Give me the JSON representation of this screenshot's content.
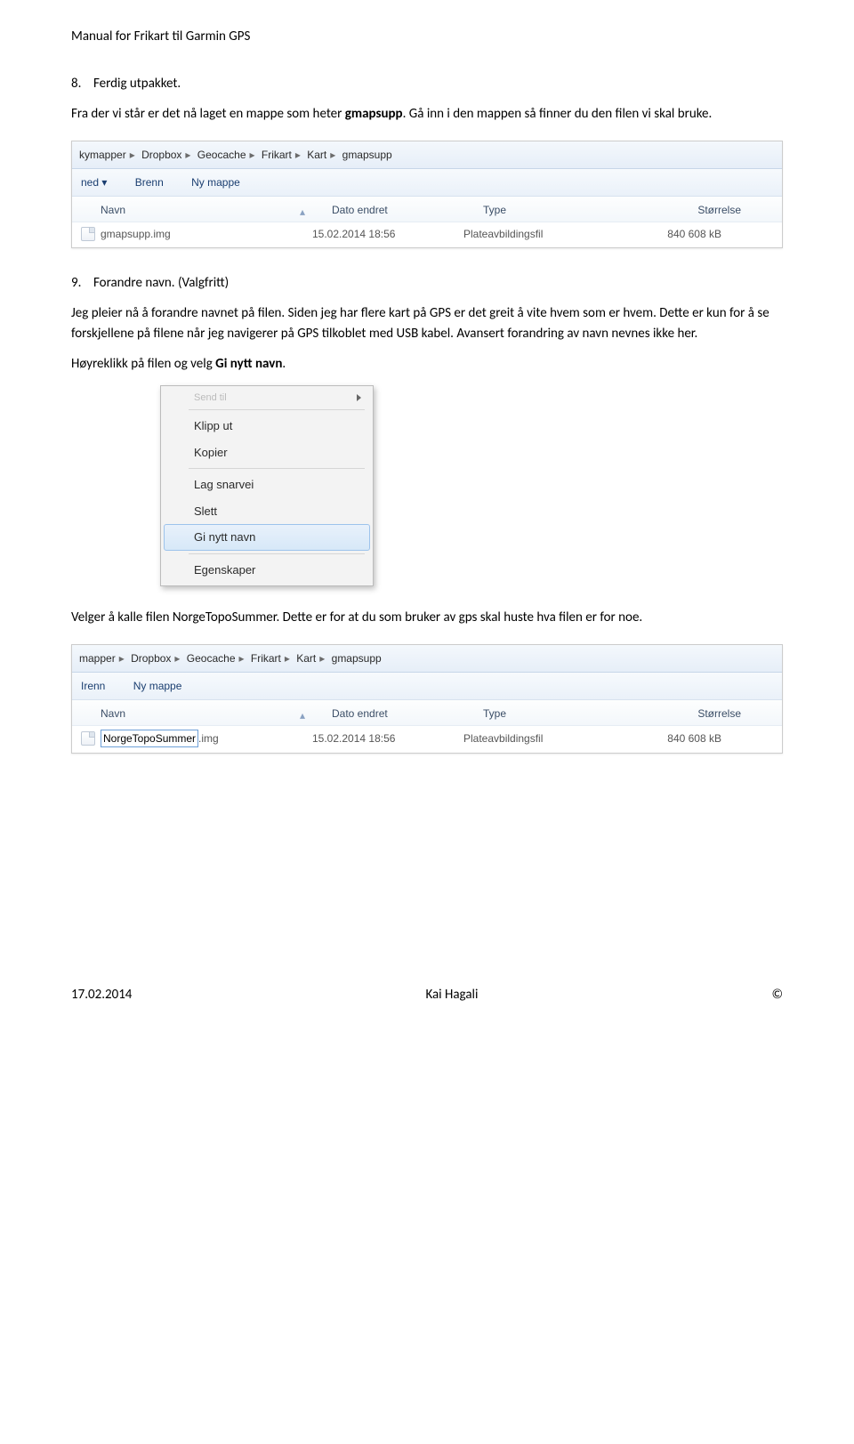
{
  "header": {
    "manual_title": "Manual for Frikart til Garmin GPS"
  },
  "section8": {
    "num": "8.",
    "heading": "Ferdig utpakket.",
    "p1_a": "Fra der vi står er det nå laget en mappe som heter ",
    "p1_bold": "gmapsupp",
    "p1_b": ". Gå inn i den mappen så finner du den filen vi skal bruke."
  },
  "explorer1": {
    "breadcrumb": [
      "kymapper",
      "Dropbox",
      "Geocache",
      "Frikart",
      "Kart",
      "gmapsupp"
    ],
    "toolbar": {
      "left": "ned ▾",
      "mid": "Brenn",
      "right": "Ny mappe"
    },
    "columns": {
      "name": "Navn",
      "date": "Dato endret",
      "type": "Type",
      "size": "Størrelse"
    },
    "row": {
      "name": "gmapsupp.img",
      "date": "15.02.2014 18:56",
      "type": "Plateavbildingsfil",
      "size": "840 608 kB"
    }
  },
  "section9": {
    "num": "9.",
    "heading": "Forandre navn. (Valgfritt)",
    "p1": "Jeg pleier nå å forandre navnet på filen. Siden jeg har flere kart på GPS er det greit å vite hvem som er hvem. Dette er kun for å se forskjellene på filene når jeg navigerer på GPS tilkoblet med USB kabel. Avansert forandring av navn nevnes ikke her.",
    "p2_a": "Høyreklikk på filen og velg ",
    "p2_bold": "Gi nytt navn",
    "p2_b": "."
  },
  "context_menu": {
    "ghost": "Send til",
    "items_top": [
      "Klipp ut",
      "Kopier"
    ],
    "items_mid": [
      "Lag snarvei",
      "Slett"
    ],
    "selected": "Gi nytt navn",
    "items_bottom": [
      "Egenskaper"
    ]
  },
  "section9b": {
    "p_a": "Velger å kalle filen NorgeTopoSummer. Dette er for at du som bruker av gps skal huste hva filen er for noe."
  },
  "explorer2": {
    "breadcrumb": [
      "mapper",
      "Dropbox",
      "Geocache",
      "Frikart",
      "Kart",
      "gmapsupp"
    ],
    "toolbar": {
      "left": "Irenn",
      "right": "Ny mappe"
    },
    "columns": {
      "name": "Navn",
      "date": "Dato endret",
      "type": "Type",
      "size": "Størrelse"
    },
    "row": {
      "name": "NorgeTopoSummer",
      "ext": ".img",
      "date": "15.02.2014 18:56",
      "type": "Plateavbildingsfil",
      "size": "840 608 kB"
    }
  },
  "footer": {
    "date": "17.02.2014",
    "author": "Kai Hagali",
    "copy": "©"
  }
}
